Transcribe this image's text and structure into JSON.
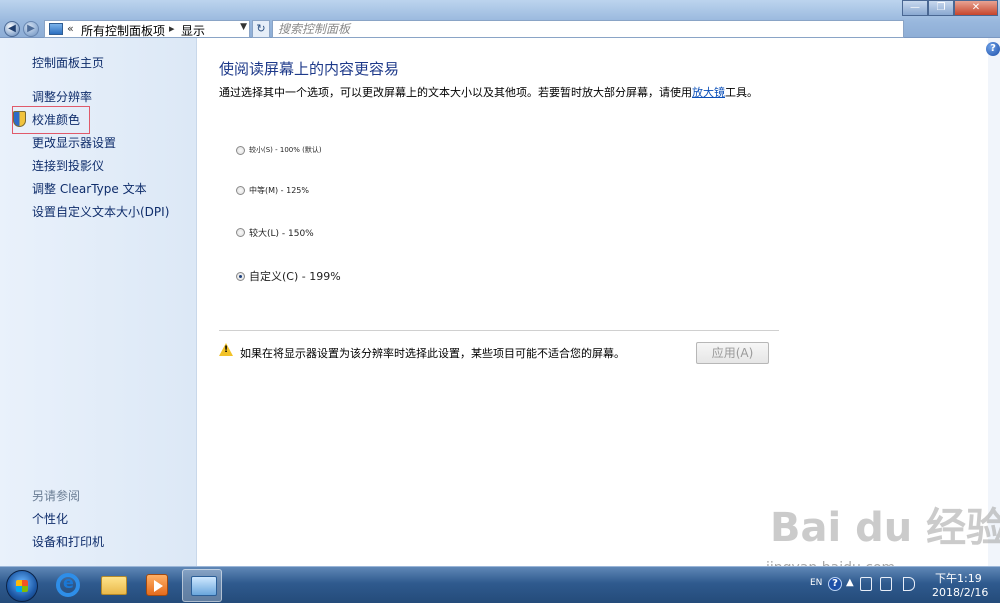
{
  "address_bar": {
    "crumbs": [
      "所有控制面板项",
      "显示"
    ],
    "search_placeholder": "搜索控制面板"
  },
  "window_buttons": {
    "minimize": "—",
    "restore": "❐",
    "close": "✕"
  },
  "sidebar": {
    "items": [
      {
        "label": "控制面板主页"
      },
      {
        "label": "调整分辨率"
      },
      {
        "label": "校准颜色"
      },
      {
        "label": "更改显示器设置"
      },
      {
        "label": "连接到投影仪"
      },
      {
        "label": "调整 ClearType 文本"
      },
      {
        "label": "设置自定义文本大小(DPI)"
      }
    ],
    "see_also_heading": "另请参阅",
    "see_also": [
      {
        "label": "个性化"
      },
      {
        "label": "设备和打印机"
      }
    ]
  },
  "main": {
    "title": "使阅读屏幕上的内容更容易",
    "description_before_link": "通过选择其中一个选项，可以更改屏幕上的文本大小以及其他项。若要暂时放大部分屏幕，请使用",
    "description_link": "放大镜",
    "description_after_link": "工具。",
    "options": [
      {
        "label": "较小(S) - 100% (默认)",
        "checked": false
      },
      {
        "label": "中等(M) - 125%",
        "checked": false
      },
      {
        "label": "较大(L) - 150%",
        "checked": false
      },
      {
        "label": "自定义(C) - 199%",
        "checked": true
      }
    ],
    "warning_text": "如果在将显示器设置为该分辨率时选择此设置，某些项目可能不适合您的屏幕。",
    "apply_label": "应用(A)"
  },
  "taskbar": {
    "language": "EN",
    "time": "下午1:19",
    "date": "2018/2/16"
  },
  "watermark": {
    "logo": "Bai du 经验",
    "url": "jingyan.baidu.com"
  }
}
